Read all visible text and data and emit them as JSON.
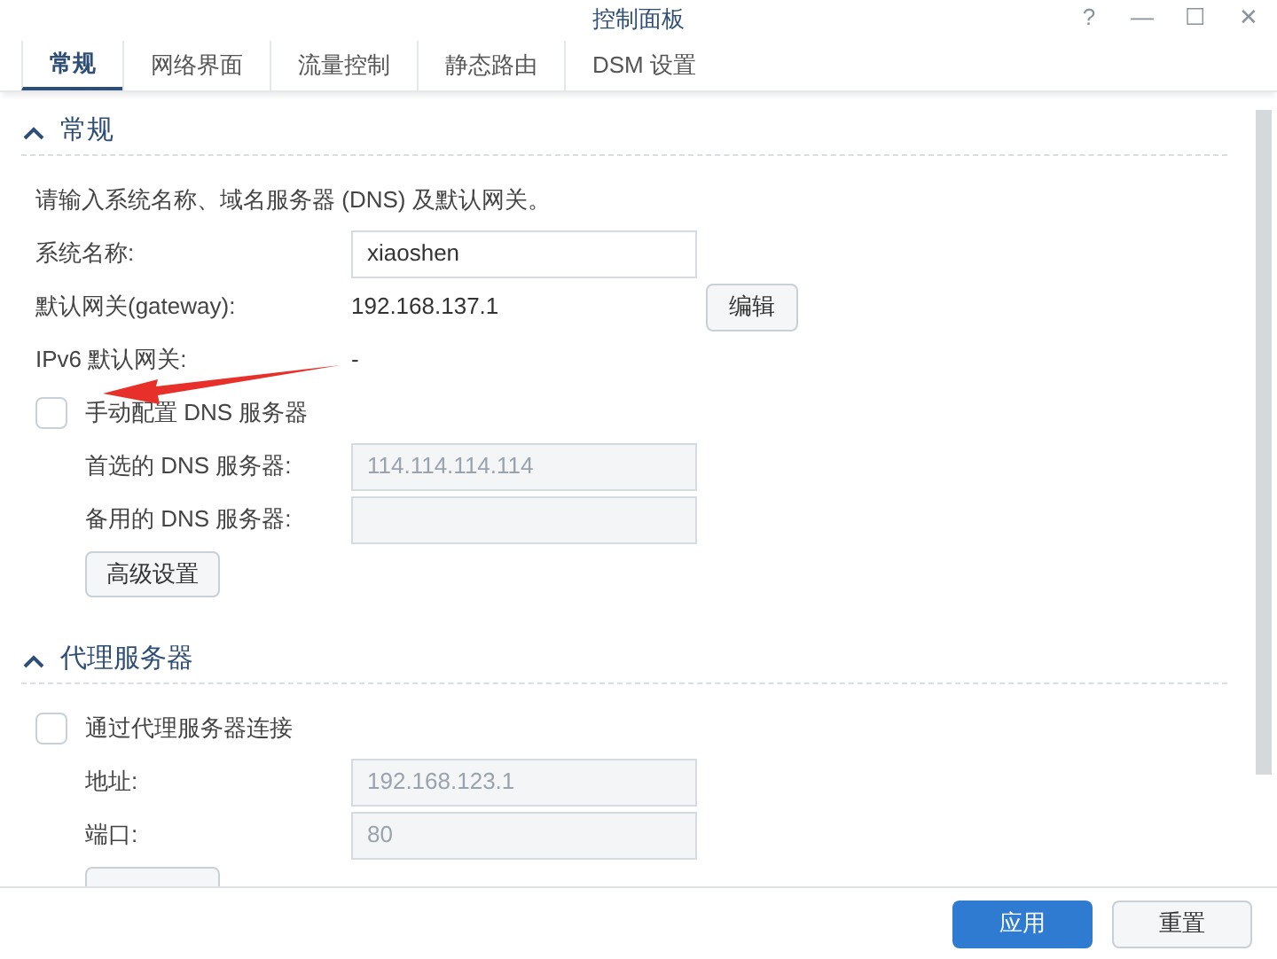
{
  "window": {
    "title": "控制面板",
    "controls": [
      "?",
      "—",
      "☐",
      "✕"
    ]
  },
  "tabs": [
    {
      "label": "常规",
      "selected": true
    },
    {
      "label": "网络界面",
      "selected": false
    },
    {
      "label": "流量控制",
      "selected": false
    },
    {
      "label": "静态路由",
      "selected": false
    },
    {
      "label": "DSM 设置",
      "selected": false
    }
  ],
  "sections": [
    {
      "title": "常规",
      "expanded": true,
      "rows": [
        {
          "kind": "text",
          "text": "请输入系统名称、域名服务器 (DNS) 及默认网关。"
        },
        {
          "kind": "field",
          "label": "系统名称:",
          "value": "xiaoshen",
          "disabled": false
        },
        {
          "kind": "value",
          "label": "默认网关(gateway):",
          "value": "192.168.137.1",
          "button": "编辑"
        },
        {
          "kind": "value",
          "label": "IPv6 默认网关:",
          "value": "-"
        },
        {
          "kind": "checkbox",
          "label": "手动配置 DNS 服务器",
          "checked": false,
          "annotated": true
        },
        {
          "kind": "subfield",
          "label": "首选的 DNS 服务器:",
          "value": "114.114.114.114",
          "disabled": true
        },
        {
          "kind": "subfield",
          "label": "备用的 DNS 服务器:",
          "disabled": true
        },
        {
          "kind": "button",
          "label": "高级设置"
        }
      ]
    },
    {
      "title": "代理服务器",
      "expanded": true,
      "rows": [
        {
          "kind": "checkbox",
          "label": "通过代理服务器连接",
          "checked": false,
          "annotated": false
        },
        {
          "kind": "subfield",
          "label": "地址:",
          "value": "192.168.123.1",
          "disabled": true
        },
        {
          "kind": "subfield",
          "label": "端口:",
          "value": "80",
          "disabled": true
        },
        {
          "kind": "button"
        }
      ]
    }
  ],
  "footer": {
    "buttons": [
      {
        "label": "应用",
        "kind": "primary"
      },
      {
        "label": "重置",
        "kind": "secondary"
      }
    ]
  }
}
